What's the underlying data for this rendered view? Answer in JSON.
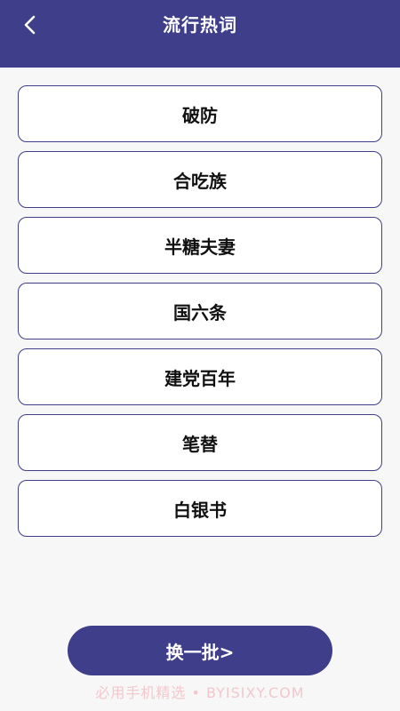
{
  "header": {
    "title": "流行热词",
    "back_icon": "chevron-left-icon"
  },
  "words": [
    {
      "label": "破防"
    },
    {
      "label": "合吃族"
    },
    {
      "label": "半糖夫妻"
    },
    {
      "label": "国六条"
    },
    {
      "label": "建党百年"
    },
    {
      "label": "笔替"
    },
    {
      "label": "白银书"
    }
  ],
  "footer": {
    "refresh_label": "换一批>"
  },
  "watermark": "必用手机精选 • BYISIXY.COM",
  "colors": {
    "primary": "#3f3e8a",
    "background": "#f7f7f7",
    "card": "#ffffff"
  }
}
